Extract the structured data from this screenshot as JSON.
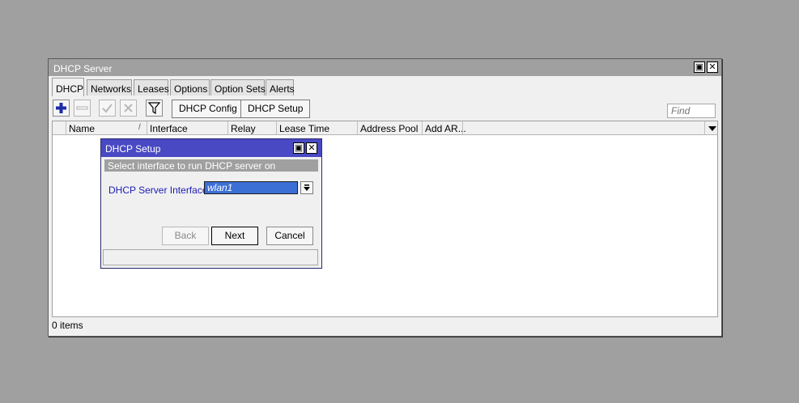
{
  "window": {
    "title": "DHCP Server",
    "restore_glyph": "▣",
    "close_glyph": "✕"
  },
  "tabs": [
    "DHCP",
    "Networks",
    "Leases",
    "Options",
    "Option Sets",
    "Alerts"
  ],
  "toolbar": {
    "add_icon": "plus-icon",
    "remove_icon": "minus-icon",
    "enable_icon": "check-icon",
    "disable_icon": "x-icon",
    "filter_icon": "filter-icon",
    "config_label": "DHCP Config",
    "setup_label": "DHCP Setup",
    "find_placeholder": "Find"
  },
  "table": {
    "columns": [
      "Name",
      "Interface",
      "Relay",
      "Lease Time",
      "Address Pool",
      "Add AR..."
    ],
    "sort_indicator": "/",
    "rows": []
  },
  "status": {
    "count": "0 items"
  },
  "dialog": {
    "title": "DHCP Setup",
    "restore_glyph": "▣",
    "close_glyph": "✕",
    "description": "Select interface to run DHCP server on",
    "field_label": "DHCP Server Interface:",
    "field_value": "wlan1",
    "back_label": "Back",
    "next_label": "Next",
    "cancel_label": "Cancel"
  },
  "colors": {
    "background": "#a0a0a0",
    "dialog_title": "#4949c4",
    "selection": "#3c6fd6",
    "label_blue": "#1c1cb4"
  }
}
